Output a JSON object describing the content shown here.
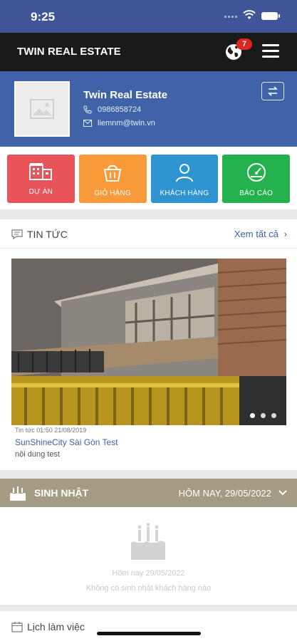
{
  "status_bar": {
    "time": "9:25"
  },
  "navbar": {
    "title": "TWIN REAL ESTATE",
    "notification_count": "7"
  },
  "profile": {
    "name": "Twin Real Estate",
    "phone": "0986858724",
    "email": "liemnm@twin.vn"
  },
  "actions": [
    {
      "label": "Dự án",
      "color": "#e9545a",
      "icon": "building-icon"
    },
    {
      "label": "Giỏ hàng",
      "color": "#f89a3a",
      "icon": "basket-icon"
    },
    {
      "label": "Khách hàng",
      "color": "#2d93d1",
      "icon": "customers-icon"
    },
    {
      "label": "Báo cáo",
      "color": "#23b14d",
      "icon": "report-gauge-icon"
    }
  ],
  "news": {
    "section_title": "TIN TỨC",
    "see_all": "Xem tất cả",
    "items": [
      {
        "meta": "Tin tức 01:50 21/08/2019",
        "title": "SunShineCity Sài Gòn Test",
        "description": "nội dung test"
      }
    ],
    "carousel_active_index": 0,
    "carousel_count": 3
  },
  "birthday": {
    "section_title": "SINH NHẬT",
    "date_label": "HÔM NAY, 29/05/2022",
    "empty_date": "Hôm nay 29/05/2022",
    "empty_message": "Không có sinh nhật khách hàng nào"
  },
  "schedule": {
    "section_title": "Lịch làm việc"
  },
  "colors": {
    "header_blue": "#3f63a6",
    "navbar_dark": "#1a1a1a",
    "badge_red": "#e02424",
    "link_blue": "#3b5fa8",
    "birthday_bar": "#a39b82"
  }
}
